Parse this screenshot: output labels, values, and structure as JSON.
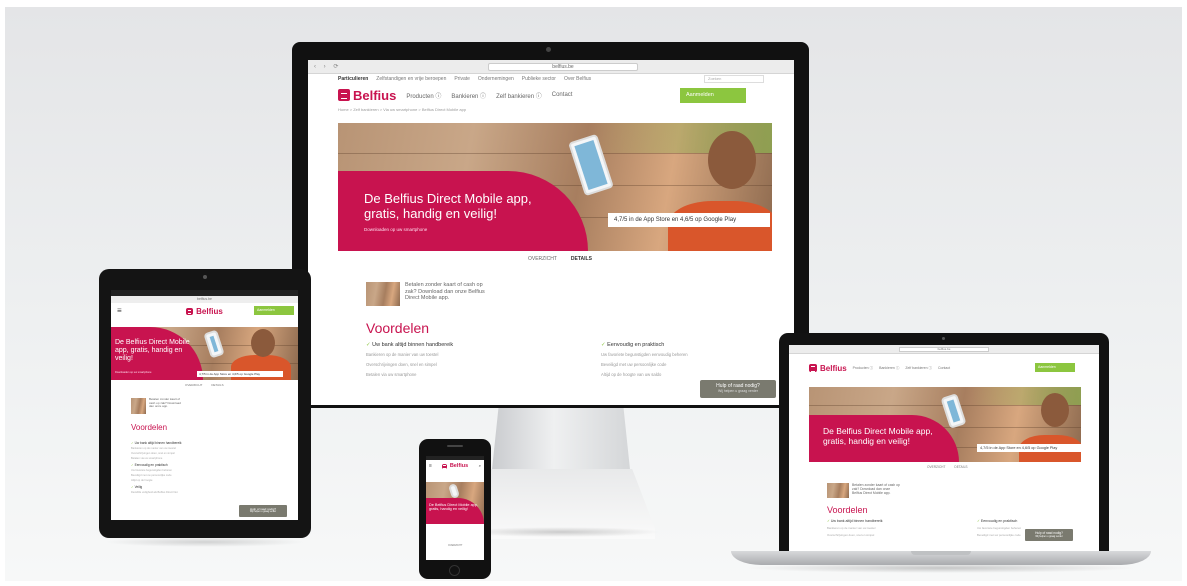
{
  "brand": {
    "name": "Belfius",
    "accent": "#c8134f",
    "green": "#8cc63f"
  },
  "desktop": {
    "url": "belfius.be",
    "topnav": [
      "Particulieren",
      "Zelfstandigen en vrije beroepen",
      "Private",
      "Ondernemingen",
      "Publieke sector",
      "Over Belfius",
      "Newsroom",
      "Job"
    ],
    "search_placeholder": "Zoeken",
    "nav": [
      "Producten ⓘ",
      "Bankieren ⓘ",
      "Zelf bankieren ⓘ",
      "Contact"
    ],
    "login": "Aanmelden",
    "breadcrumb": "Home > Zelf bankieren > Via uw smartphone > Belfius Direct Mobile app",
    "hero_title": "De Belfius Direct Mobile app, gratis, handig en veilig!",
    "hero_sub": "Downloaden op uw smartphone",
    "rating": "4,7/5 in de App Store en 4,6/5 op Google Play",
    "tabs": [
      "OVERZICHT",
      "DETAILS"
    ],
    "intro": "Betalen zonder kaart of cash op zak? Download dan onze Belfius Direct Mobile app.",
    "benefits_title": "Voordelen",
    "col1_head": "Uw bank altijd binnen handbereik",
    "col1_items": [
      "Bankieren op de manier van uw toestel",
      "Overschrijvingen doen, snel en simpel",
      "Betalen via uw smartphone"
    ],
    "col2_head": "Eenvoudig en praktisch",
    "col2_items": [
      "Uw favoriete begunstigden eenvoudig beheren",
      "Beveiligd met uw persoonlijke code",
      "Altijd op de hoogte van uw saldo"
    ],
    "help_title": "Hulp of raad nodig?",
    "help_sub": "Wij helpen u graag verder"
  },
  "tablet": {
    "url": "belfius.be",
    "login": "Aanmelden",
    "hero_title": "De Belfius Direct Mobile app, gratis, handig en veilig!",
    "hero_sub": "Downloaden op uw smartphone",
    "rating": "4,7/5 in de App Store en 4,6/5 op Google Play",
    "tabs": [
      "OVERZICHT",
      "DETAILS"
    ],
    "intro": "Betalen zonder kaart of cash op zak? Download dan onze app.",
    "benefits_title": "Voordelen",
    "sections": [
      {
        "head": "Uw bank altijd binnen handbereik",
        "items": [
          "Bankieren op de manier van uw toestel",
          "Overschrijvingen doen, snel en simpel",
          "Betalen via uw smartphone"
        ]
      },
      {
        "head": "Eenvoudig en praktisch",
        "items": [
          "Uw favoriete begunstigden beheren",
          "Beveiligd met uw persoonlijke code",
          "Altijd op de hoogte"
        ]
      },
      {
        "head": "Veilig",
        "items": [
          "Dezelfde veiligheid als Belfius Direct Net"
        ]
      }
    ],
    "help_title": "Hulp of raad nodig?",
    "help_sub": "Wij helpen u graag verder"
  },
  "phone": {
    "hero_title": "De Belfius Direct Mobile app, gratis, handig en veilig!",
    "tab": "OVERZICHT"
  },
  "laptop": {
    "url": "belfius.be",
    "nav": [
      "Producten ⓘ",
      "Bankieren ⓘ",
      "Zelf bankieren ⓘ",
      "Contact"
    ],
    "login": "Aanmelden",
    "hero_title": "De Belfius Direct Mobile app, gratis, handig en veilig!",
    "rating": "4,7/5 in de App Store en 4,6/5 op Google Play",
    "tabs": [
      "OVERZICHT",
      "DETAILS"
    ],
    "intro": "Betalen zonder kaart of cash op zak? Download dan onze Belfius Direct Mobile app.",
    "benefits_title": "Voordelen",
    "col1_head": "Uw bank altijd binnen handbereik",
    "col1_items": [
      "Bankieren op de manier van uw toestel",
      "Overschrijvingen doen, snel en simpel"
    ],
    "col2_head": "Eenvoudig en praktisch",
    "col2_items": [
      "Uw favoriete begunstigden beheren",
      "Beveiligd met uw persoonlijke code"
    ],
    "help_title": "Hulp of raad nodig?",
    "help_sub": "Wij helpen u graag verder"
  }
}
